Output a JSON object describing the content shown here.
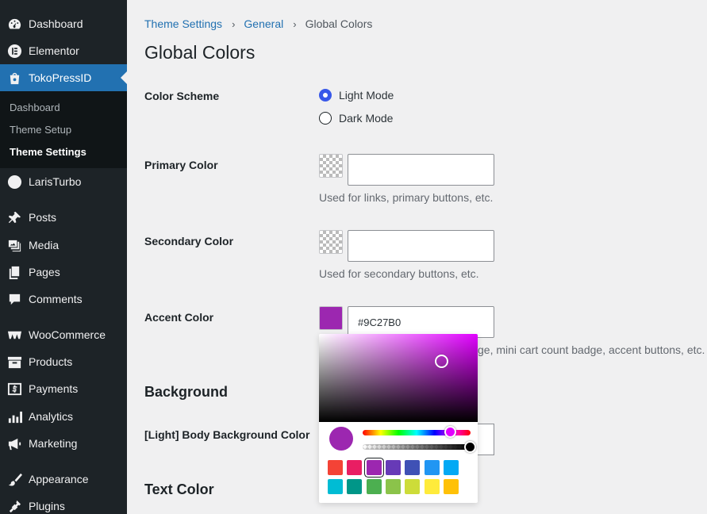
{
  "sidebar": {
    "items": [
      {
        "label": "Dashboard",
        "icon": "dashboard-icon"
      },
      {
        "label": "Elementor",
        "icon": "elementor-icon"
      },
      {
        "label": "TokoPressID",
        "icon": "shopping-bag-icon"
      },
      {
        "label": "LarisTurbo",
        "icon": "laristurbo-icon"
      },
      {
        "label": "Posts",
        "icon": "pin-icon"
      },
      {
        "label": "Media",
        "icon": "media-icon"
      },
      {
        "label": "Pages",
        "icon": "pages-icon"
      },
      {
        "label": "Comments",
        "icon": "comment-icon"
      },
      {
        "label": "WooCommerce",
        "icon": "woocommerce-icon"
      },
      {
        "label": "Products",
        "icon": "archive-icon"
      },
      {
        "label": "Payments",
        "icon": "dollar-icon"
      },
      {
        "label": "Analytics",
        "icon": "bar-chart-icon"
      },
      {
        "label": "Marketing",
        "icon": "megaphone-icon"
      },
      {
        "label": "Appearance",
        "icon": "paintbrush-icon"
      },
      {
        "label": "Plugins",
        "icon": "plugin-icon"
      }
    ],
    "submenu": [
      {
        "label": "Dashboard"
      },
      {
        "label": "Theme Setup"
      },
      {
        "label": "Theme Settings"
      }
    ]
  },
  "breadcrumb": {
    "items": [
      "Theme Settings",
      "General"
    ],
    "current": "Global Colors"
  },
  "page": {
    "title": "Global Colors"
  },
  "color_scheme": {
    "label": "Color Scheme",
    "options": [
      "Light Mode",
      "Dark Mode"
    ],
    "selected": "Light Mode"
  },
  "primary_color": {
    "label": "Primary Color",
    "value": "",
    "description": "Used for links, primary buttons, etc."
  },
  "secondary_color": {
    "label": "Secondary Color",
    "value": "",
    "description": "Used for secondary buttons, etc."
  },
  "accent_color": {
    "label": "Accent Color",
    "value": "#9C27B0",
    "description_visible": "ge, mini cart count badge, accent buttons, etc."
  },
  "background_section": {
    "title": "Background"
  },
  "body_bg": {
    "label": "[Light] Body Background Color"
  },
  "text_section": {
    "title": "Text Color"
  },
  "picker": {
    "current": "#9c27b0",
    "presets_row1": [
      "#f44336",
      "#e91e63",
      "#9c27b0",
      "#673ab7",
      "#3f51b5",
      "#2196f3",
      "#03a9f4"
    ],
    "presets_row2": [
      "#00bcd4",
      "#009688",
      "#4caf50",
      "#8bc34a",
      "#cddc39",
      "#ffeb3b",
      "#ffc107"
    ]
  },
  "colors": {
    "accent": "#2271b1",
    "sidebar_bg": "#1d2327",
    "radio_checked": "#3858e9"
  }
}
